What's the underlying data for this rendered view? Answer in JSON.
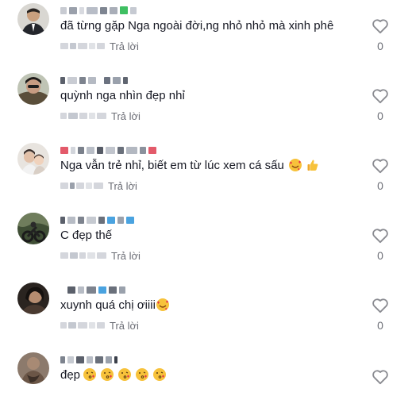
{
  "reply_label": "Trả lời",
  "comments": [
    {
      "text": "đã từng gặp Nga ngoài đời,ng nhỏ nhỏ mà xinh phê",
      "likes": "0",
      "emojis": []
    },
    {
      "text": "quỳnh nga nhìn đẹp nhỉ",
      "likes": "0",
      "emojis": []
    },
    {
      "text": "Nga vẫn trẻ nhỉ, biết em từ lúc xem cá sấu",
      "likes": "0",
      "emojis": [
        "smiling-face-with-hearts",
        "thumbs-up"
      ]
    },
    {
      "text": "C đẹp thế",
      "likes": "0",
      "emojis": []
    },
    {
      "text": "xuynh quá chị ơiiii",
      "likes": "0",
      "emojis": [
        "smiling-face-with-hearts"
      ]
    },
    {
      "text": "đẹp",
      "likes": "",
      "emojis": [
        "kissing-face",
        "kissing-face",
        "kissing-face",
        "kissing-face",
        "kissing-face"
      ]
    }
  ],
  "colors": {
    "text": "#161823",
    "secondary": "#6b6d75",
    "heart_outline": "#8a8b91",
    "emoji_face": "#f7c23b",
    "heart_red": "#e8324a"
  }
}
